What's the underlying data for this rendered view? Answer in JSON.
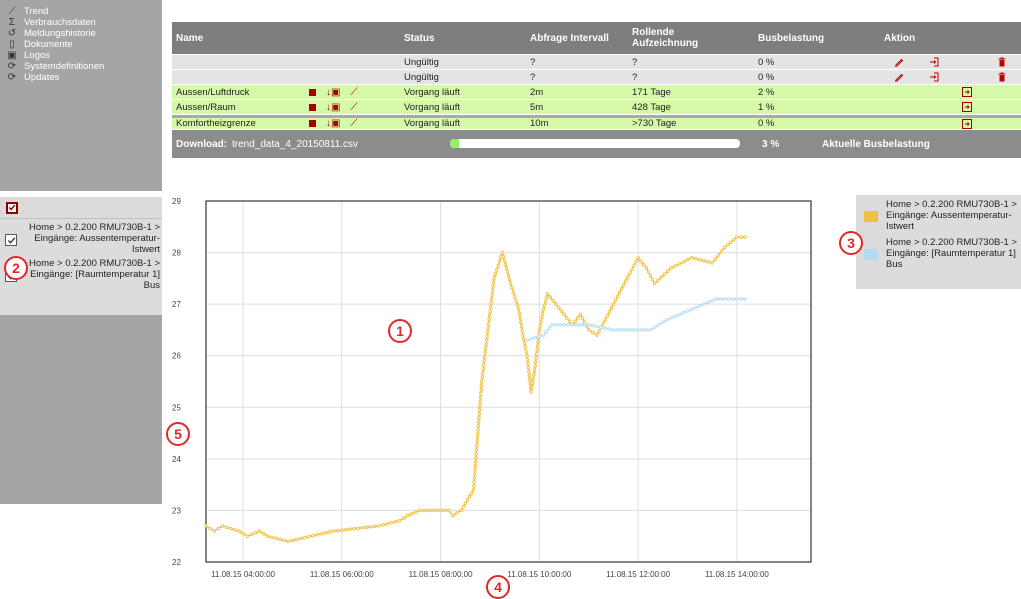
{
  "nav": {
    "items": [
      {
        "label": "Trend",
        "icon": "trend-icon",
        "glyph": "⟋"
      },
      {
        "label": "Verbrauchsdaten",
        "icon": "sigma-icon",
        "glyph": "Σ"
      },
      {
        "label": "Meldungshistorie",
        "icon": "history-icon",
        "glyph": "↺"
      },
      {
        "label": "Dokumente",
        "icon": "document-icon",
        "glyph": "▯"
      },
      {
        "label": "Logos",
        "icon": "image-icon",
        "glyph": "▣"
      },
      {
        "label": "Systemdefinitionen",
        "icon": "sync-icon",
        "glyph": "⟳"
      },
      {
        "label": "Updates",
        "icon": "update-icon",
        "glyph": "⟳"
      }
    ]
  },
  "legend_panel": {
    "items": [
      {
        "label": "Home > 0.2.200 RMU730B-1 > Eingänge: Aussentemperatur-Istwert",
        "checked": true
      },
      {
        "label": "Home > 0.2.200 RMU730B-1 > Eingänge: [Raumtemperatur 1] Bus",
        "checked": true
      }
    ]
  },
  "table": {
    "headers": {
      "name": "Name",
      "status": "Status",
      "interval": "Abfrage Intervall",
      "rolling": "Rollende Aufzeichnung",
      "busload": "Busbelastung",
      "action": "Aktion"
    },
    "rows": [
      {
        "name": "",
        "status": "Ungültig",
        "interval": "?",
        "rolling": "?",
        "busload": "0 %",
        "type": "invalid"
      },
      {
        "name": "",
        "status": "Ungültig",
        "interval": "?",
        "rolling": "?",
        "busload": "0 %",
        "type": "invalid"
      },
      {
        "name": "Aussen/Luftdruck",
        "status": "Vorgang läuft",
        "interval": "2m",
        "rolling": "171 Tage",
        "busload": "2 %",
        "type": "running"
      },
      {
        "name": "Aussen/Raum",
        "status": "Vorgang läuft",
        "interval": "5m",
        "rolling": "428 Tage",
        "busload": "1 %",
        "type": "running"
      },
      {
        "name": "Komfortheizgrenze",
        "status": "Vorgang läuft",
        "interval": "10m",
        "rolling": ">730 Tage",
        "busload": "0 %",
        "type": "running"
      }
    ],
    "download": {
      "label": "Download:",
      "file": "trend_data_4_20150811.csv",
      "progress_percent": 3,
      "progress_label": "3 %",
      "current_bus_label": "Aktuelle Busbelastung"
    }
  },
  "colors": {
    "series1": "#f0c040",
    "series2": "#b4dcf0",
    "running_row": "#d5f9a8",
    "stop": "#a00000"
  },
  "markers": [
    "1",
    "2",
    "3",
    "4",
    "5"
  ],
  "chart_data": {
    "type": "line",
    "ylim": [
      22,
      29
    ],
    "yticks": [
      "22",
      "23",
      "24",
      "25",
      "26",
      "27",
      "28",
      "29"
    ],
    "xlim": [
      "11.08.15 03:15",
      "11.08.15 15:30"
    ],
    "xticks": [
      "11.08.15 04:00:00",
      "11.08.15 06:00:00",
      "11.08.15 08:00:00",
      "11.08.15 10:00:00",
      "11.08.15 12:00:00",
      "11.08.15 14:00:00"
    ],
    "grid": true,
    "series": [
      {
        "name": "Home > 0.2.200 RMU730B-1 > Eingänge: Aussentemperatur-Istwert",
        "color": "#f0c040",
        "points": [
          [
            "03:15",
            22.7
          ],
          [
            "03:25",
            22.6
          ],
          [
            "03:35",
            22.7
          ],
          [
            "03:55",
            22.6
          ],
          [
            "04:05",
            22.5
          ],
          [
            "04:20",
            22.6
          ],
          [
            "04:30",
            22.5
          ],
          [
            "04:55",
            22.4
          ],
          [
            "05:50",
            22.6
          ],
          [
            "06:45",
            22.7
          ],
          [
            "07:10",
            22.8
          ],
          [
            "07:20",
            22.9
          ],
          [
            "07:35",
            23.0
          ],
          [
            "08:10",
            23.0
          ],
          [
            "08:15",
            22.9
          ],
          [
            "08:25",
            23.0
          ],
          [
            "08:40",
            23.4
          ],
          [
            "08:50",
            25.5
          ],
          [
            "09:05",
            27.5
          ],
          [
            "09:15",
            28.0
          ],
          [
            "09:25",
            27.4
          ],
          [
            "09:35",
            26.9
          ],
          [
            "09:40",
            26.4
          ],
          [
            "09:45",
            26.0
          ],
          [
            "09:50",
            25.3
          ],
          [
            "09:55",
            25.8
          ],
          [
            "10:00",
            26.5
          ],
          [
            "10:05",
            26.9
          ],
          [
            "10:10",
            27.2
          ],
          [
            "10:20",
            27.0
          ],
          [
            "10:40",
            26.6
          ],
          [
            "10:50",
            26.8
          ],
          [
            "11:00",
            26.5
          ],
          [
            "11:10",
            26.4
          ],
          [
            "11:20",
            26.7
          ],
          [
            "11:30",
            27.0
          ],
          [
            "11:40",
            27.3
          ],
          [
            "11:50",
            27.6
          ],
          [
            "12:00",
            27.9
          ],
          [
            "12:10",
            27.7
          ],
          [
            "12:20",
            27.4
          ],
          [
            "12:40",
            27.7
          ],
          [
            "13:05",
            27.9
          ],
          [
            "13:30",
            27.8
          ],
          [
            "13:45",
            28.1
          ],
          [
            "14:00",
            28.3
          ],
          [
            "14:10",
            28.3
          ]
        ]
      },
      {
        "name": "Home > 0.2.200 RMU730B-1 > Eingänge: [Raumtemperatur 1] Bus",
        "color": "#b4dcf0",
        "points": [
          [
            "09:45",
            26.3
          ],
          [
            "10:05",
            26.4
          ],
          [
            "10:15",
            26.6
          ],
          [
            "10:45",
            26.6
          ],
          [
            "11:00",
            26.6
          ],
          [
            "11:30",
            26.5
          ],
          [
            "12:15",
            26.5
          ],
          [
            "12:35",
            26.7
          ],
          [
            "12:50",
            26.8
          ],
          [
            "13:20",
            27.0
          ],
          [
            "13:35",
            27.1
          ],
          [
            "14:10",
            27.1
          ]
        ]
      }
    ]
  }
}
